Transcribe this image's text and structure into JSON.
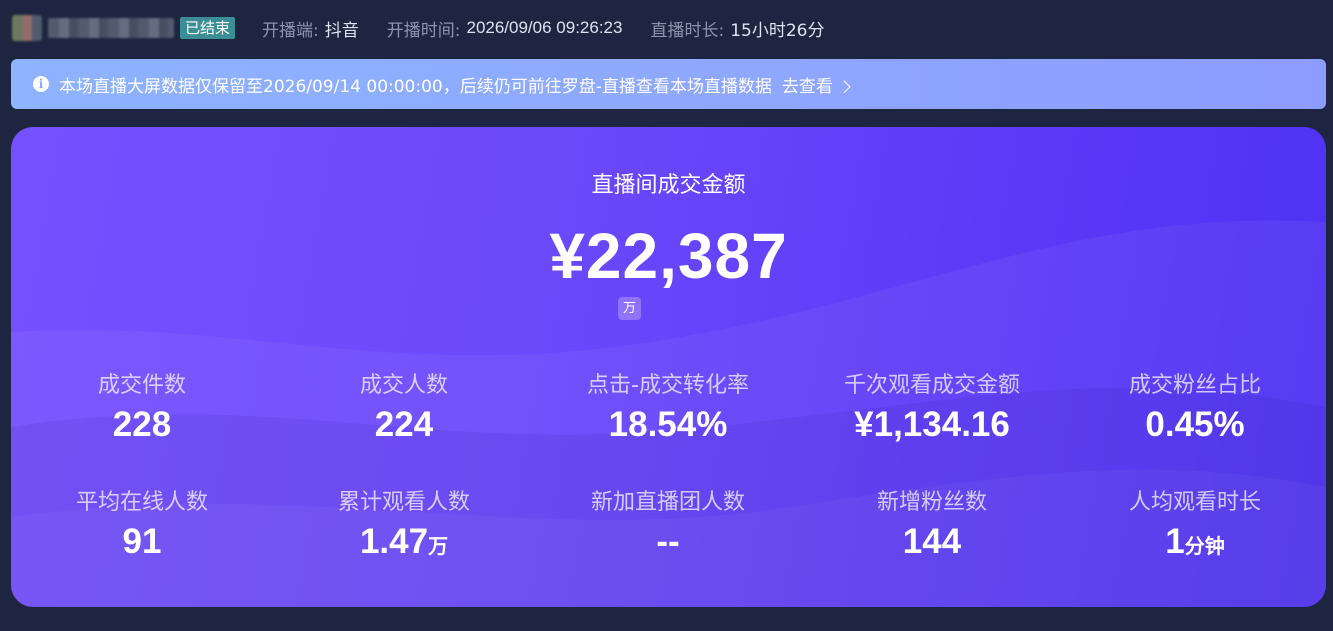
{
  "header": {
    "status": "已结束",
    "platform_label": "开播端:",
    "platform_value": "抖音",
    "start_label": "开播时间:",
    "start_value": "2026/09/06 09:26:23",
    "duration_label": "直播时长:",
    "duration_value": "15小时26分"
  },
  "notice": {
    "icon": "info-icon",
    "text": "本场直播大屏数据仅保留至2026/09/14 00:00:00，后续仍可前往罗盘-直播查看本场直播数据",
    "link": "去查看"
  },
  "summary": {
    "title": "直播间成交金额",
    "value": "¥22,387",
    "unit_toggle": "万"
  },
  "metrics": [
    {
      "label": "成交件数",
      "value": "228",
      "unit": ""
    },
    {
      "label": "成交人数",
      "value": "224",
      "unit": ""
    },
    {
      "label": "点击-成交转化率",
      "value": "18.54%",
      "unit": ""
    },
    {
      "label": "千次观看成交金额",
      "value": "¥1,134.16",
      "unit": ""
    },
    {
      "label": "成交粉丝占比",
      "value": "0.45%",
      "unit": ""
    },
    {
      "label": "平均在线人数",
      "value": "91",
      "unit": ""
    },
    {
      "label": "累计观看人数",
      "value": "1.47",
      "unit": "万"
    },
    {
      "label": "新加直播团人数",
      "value": "--",
      "unit": ""
    },
    {
      "label": "新增粉丝数",
      "value": "144",
      "unit": ""
    },
    {
      "label": "人均观看时长",
      "value": "1",
      "unit": "分钟"
    }
  ],
  "colors": {
    "page_bg": "#1e2540",
    "status_badge": "#3b8e96",
    "notice_bg": "#8eb3ff",
    "card_bg": "#6a49fb"
  }
}
